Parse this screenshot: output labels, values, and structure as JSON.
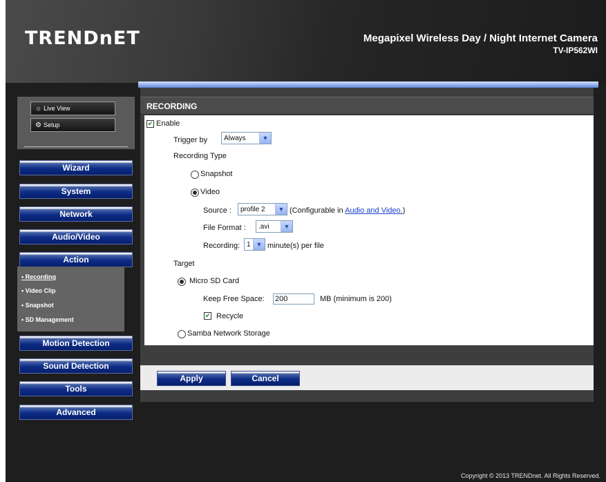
{
  "header": {
    "logo": "TRENDnET",
    "product_title": "Megapixel Wireless Day / Night Internet Camera",
    "model": "TV-IP562WI"
  },
  "mode_buttons": {
    "live_view": "Live View",
    "setup": "Setup"
  },
  "nav": [
    "Wizard",
    "System",
    "Network",
    "Audio/Video",
    "Action",
    "Motion Detection",
    "Sound Detection",
    "Tools",
    "Advanced"
  ],
  "action_submenu": [
    "Recording",
    "Video Clip",
    "Snapshot",
    "SD Management"
  ],
  "section_title": "RECORDING",
  "form": {
    "enable_label": "Enable",
    "enable_checked": true,
    "trigger_label": "Trigger by",
    "trigger_value": "Always",
    "recording_type_label": "Recording Type",
    "snapshot_label": "Snapshot",
    "video_label": "Video",
    "recording_type_selected": "Video",
    "source_label": "Source :",
    "source_value": "profile 2",
    "source_note_prefix": "(Configurable in ",
    "source_note_link": "Audio and Video.",
    "source_note_suffix": ")",
    "file_format_label": "File Format :",
    "file_format_value": ".avi",
    "recording_label": "Recording:",
    "recording_value": "1",
    "recording_unit": "minute(s) per file",
    "target_label": "Target",
    "micro_sd_label": "Micro SD Card",
    "keep_free_label": "Keep Free Space:",
    "keep_free_value": "200",
    "keep_free_note": "MB (minimum is 200)",
    "recycle_label": "Recycle",
    "recycle_checked": true,
    "samba_label": "Samba Network Storage",
    "target_selected": "Micro SD Card"
  },
  "buttons": {
    "apply": "Apply",
    "cancel": "Cancel"
  },
  "footer": {
    "copyright": "Copyright © 2013 TRENDnet. All Rights Reserved."
  }
}
